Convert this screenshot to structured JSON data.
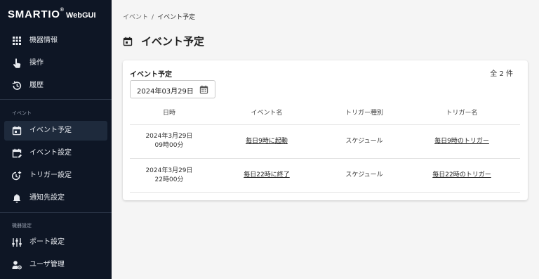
{
  "brand": {
    "name": "SMARTIO",
    "reg": "®",
    "sub": "WebGUI"
  },
  "sidebar": {
    "top_items": [
      {
        "label": "機器情報",
        "icon": "grid-icon"
      },
      {
        "label": "操作",
        "icon": "hand-pointer-icon"
      },
      {
        "label": "履歴",
        "icon": "history-icon"
      }
    ],
    "event_section_label": "イベント",
    "event_items": [
      {
        "label": "イベント予定",
        "icon": "calendar-icon",
        "active": true
      },
      {
        "label": "イベント設定",
        "icon": "calendar-edit-icon"
      },
      {
        "label": "トリガー設定",
        "icon": "timer-add-icon"
      },
      {
        "label": "通知先設定",
        "icon": "bell-icon"
      }
    ],
    "device_section_label": "機器設定",
    "device_items": [
      {
        "label": "ポート設定",
        "icon": "sliders-icon"
      },
      {
        "label": "ユーザ管理",
        "icon": "user-gear-icon"
      }
    ]
  },
  "breadcrumb": {
    "parent": "イベント",
    "separator": "/",
    "current": "イベント予定"
  },
  "page": {
    "title": "イベント予定"
  },
  "card": {
    "title": "イベント予定",
    "count": "全 2 件",
    "date_value": "2024年03月29日",
    "columns": [
      "日時",
      "イベント名",
      "トリガー種別",
      "トリガー名"
    ],
    "rows": [
      {
        "date": "2024年3月29日",
        "time": "09時00分",
        "event": "毎日9時に起動",
        "trigger_type": "スケジュール",
        "trigger": "毎日9時のトリガー"
      },
      {
        "date": "2024年3月29日",
        "time": "22時00分",
        "event": "毎日22時に終了",
        "trigger_type": "スケジュール",
        "trigger": "毎日22時のトリガー"
      }
    ]
  },
  "colors": {
    "sidebar_bg": "#0e1625",
    "active_item_bg": "#1e2a3c",
    "page_bg": "#f5f5f5"
  }
}
